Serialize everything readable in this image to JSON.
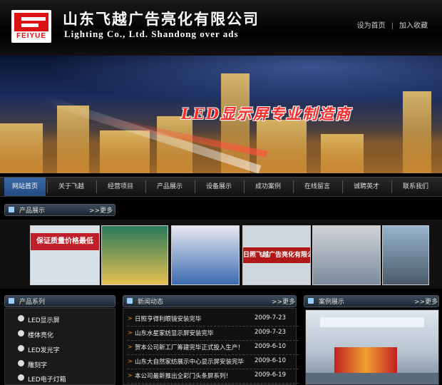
{
  "header": {
    "logo_text": "FEIYUE",
    "company_cn": "山东飞越广告亮化有限公司",
    "company_en": "Lighting Co., Ltd. Shandong over ads",
    "links": [
      "设为首页",
      "加入收藏"
    ],
    "link_separator": "|"
  },
  "banner": {
    "slogan": "LED显示屏专业制造商"
  },
  "nav": {
    "items": [
      "网站首页",
      "关于飞越",
      "经营项目",
      "产品展示",
      "设备展示",
      "成功案例",
      "在线留言",
      "诚聘英才",
      "联系我们"
    ],
    "active_index": 0
  },
  "product_showcase": {
    "title": "产品展示",
    "more": ">>更多",
    "thumbs": [
      {
        "label": "保证质量价格最低",
        "colors": [
          "#d8e0e8",
          "#c0202a"
        ]
      },
      {
        "label": "",
        "colors": [
          "#2a7a5a",
          "#e6c050"
        ]
      },
      {
        "label": "",
        "colors": [
          "#e8e8f0",
          "#3a6ab0"
        ]
      },
      {
        "label": "日照飞越广告亮化有限公",
        "colors": [
          "#cfd6de",
          "#b01818"
        ]
      },
      {
        "label": "",
        "colors": [
          "#d0d4d8",
          "#7a8a9a"
        ]
      },
      {
        "label": "",
        "colors": [
          "#98b4cc",
          "#4a5a6a"
        ]
      }
    ]
  },
  "categories": {
    "title": "产品系列",
    "items": [
      "LED显示屏",
      "楼体亮化",
      "LED发光字",
      "雕刻字",
      "LED电子灯箱"
    ]
  },
  "news": {
    "title": "新闻动态",
    "more": ">>更多",
    "items": [
      {
        "title": "日照亨得利眼镜安装完毕",
        "date": "2009-7-23"
      },
      {
        "title": "山东水星家纺显示屏安装完毕",
        "date": "2009-7-23"
      },
      {
        "title": "贺本公司新工厂筹建完毕正式投入生产！",
        "date": "2009-6-10"
      },
      {
        "title": "山东大自然家纺展示中心显示屏安装完毕",
        "date": "2009-6-10"
      },
      {
        "title": "本公司最新推出全彩门头条屏系列！",
        "date": "2009-6-19"
      }
    ]
  },
  "cases": {
    "title": "案例展示",
    "more": ">>更多"
  },
  "colors": {
    "nav_active": "#2f5d96",
    "slogan": "#ff2a2a",
    "brand_red": "#dd1111"
  }
}
